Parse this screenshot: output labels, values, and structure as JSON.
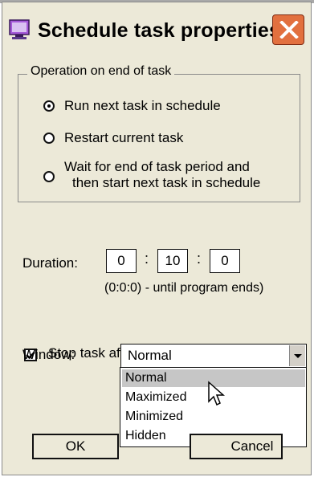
{
  "window": {
    "title": "Schedule task properties",
    "icon": "monitor-app-icon",
    "close_icon": "close-x-icon",
    "close_color": "#e2703f"
  },
  "operation_group": {
    "legend": "Operation on end of task",
    "options": [
      {
        "label": "Run next task in schedule",
        "checked": true
      },
      {
        "label": "Restart current task",
        "checked": false
      },
      {
        "label_line1": "Wait for end of task period and",
        "label_line2": "then start next task in schedule",
        "checked": false
      }
    ]
  },
  "duration": {
    "label": "Duration:",
    "hours": "0",
    "minutes": "10",
    "seconds": "0",
    "hint": "(0:0:0) - until program ends)"
  },
  "stop_task": {
    "label": "Stop task after duration period ends",
    "checked": true
  },
  "window_mode": {
    "label": "Window:",
    "selected": "Normal",
    "options": [
      "Normal",
      "Maximized",
      "Minimized",
      "Hidden"
    ]
  },
  "buttons": {
    "ok": "OK",
    "cancel": "Cancel"
  }
}
